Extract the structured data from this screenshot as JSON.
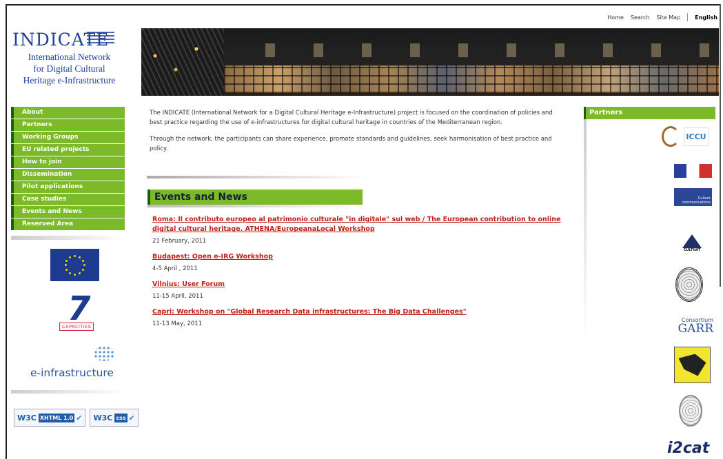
{
  "top_links": {
    "home": "Home",
    "search": "Search",
    "sitemap": "Site Map",
    "language": "English"
  },
  "logo": {
    "word": "INDICATE",
    "subtitle_line1": "International Network",
    "subtitle_line2": "for Digital Cultural",
    "subtitle_line3": "Heritage e-Infrastructure"
  },
  "nav": {
    "items": [
      {
        "label": "About"
      },
      {
        "label": "Partners"
      },
      {
        "label": "Working Groups"
      },
      {
        "label": "EU related projects"
      },
      {
        "label": "How to join"
      },
      {
        "label": "Dissemination"
      },
      {
        "label": "Pilot applications"
      },
      {
        "label": "Case studies"
      },
      {
        "label": "Events and News"
      },
      {
        "label": "Reserved Area"
      }
    ]
  },
  "left_logos": {
    "fp7_caption": "CAPACITIES",
    "einfra_text": "e-infrastructure",
    "w3c_xhtml": "W3C",
    "w3c_xhtml_tag": "XHTML 1.0",
    "w3c_css": "W3C",
    "w3c_css_tag": "css"
  },
  "intro": {
    "p1": "The INDICATE (International Network for a Digital Cultural Heritage e-Infrastructure) project is focused on the coordination of policies and best practice regarding the use of e-infrastructures for digital cultural heritage in countries of the Mediterranean region.",
    "p2": "Through the network, the participants can share experience, promote standards and guidelines, seek harmonisation of best practice and policy."
  },
  "events": {
    "header": "Events and News",
    "items": [
      {
        "title": "Roma: Il contributo europeo al patrimonio culturale \"in digitale\" sul web / The European contribution to online digital cultural heritage. ATHENA/EuropeanaLocal Workshop",
        "date": "21 February, 2011"
      },
      {
        "title": "Budapest: Open e-IRG Workshop",
        "date": "4-5 April , 2011"
      },
      {
        "title": "Vilnius: User Forum",
        "date": "11-15 April, 2011"
      },
      {
        "title": "Capri: Workshop on \"Global Research Data infrastructures: The Big Data Challenges\"",
        "date": "11-13 May, 2011"
      }
    ]
  },
  "partners": {
    "header": "Partners",
    "iccu": "ICCU",
    "culture": "Culture communications",
    "cultnat": "CULTNAT",
    "garr_top": "Consortium",
    "garr": "GARR",
    "i2cat": "i2cat"
  },
  "colors": {
    "nav_green": "#7dba2a",
    "nav_dark_border": "#1e5c1a",
    "logo_blue": "#1f3f9a",
    "link_red": "#c0201a"
  }
}
